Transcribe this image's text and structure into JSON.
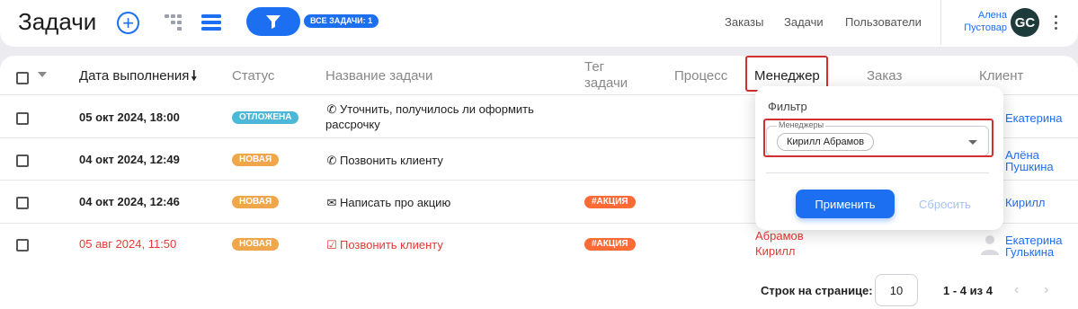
{
  "header": {
    "title": "Задачи",
    "add_symbol": "+",
    "all_tasks_badge": "ВСЕ ЗАДАЧИ: 1",
    "nav": [
      "Заказы",
      "Задачи",
      "Пользователи"
    ],
    "user": {
      "first_name": "Алена",
      "last_name": "Пустовар",
      "initials": "GC"
    }
  },
  "table": {
    "columns": {
      "due_date": "Дата выполнения",
      "sort_arrow": "🠗",
      "status": "Статус",
      "task_name": "Название задачи",
      "tag_line1": "Тег",
      "tag_line2": "задачи",
      "process": "Процесс",
      "manager": "Менеджер",
      "order": "Заказ",
      "client": "Клиент"
    },
    "rows": [
      {
        "date": "05 окт 2024, 18:00",
        "status": "ОТЛОЖЕНА",
        "status_color": "#4cb8d8",
        "task_icon": "phone-icon",
        "task_line1": "Уточнить, получилось ли оформить",
        "task_line2": "рассрочку",
        "tag": "",
        "client_line1": "Екатерина",
        "client_line2": ""
      },
      {
        "date": "04 окт 2024, 12:49",
        "status": "НОВАЯ",
        "status_color": "#f0a64a",
        "task_icon": "phone-icon",
        "task_line1": "Позвонить клиенту",
        "task_line2": "",
        "tag": "",
        "client_line1": "Алёна",
        "client_line2": "Пушкина"
      },
      {
        "date": "04 окт 2024, 12:46",
        "status": "НОВАЯ",
        "status_color": "#f0a64a",
        "task_icon": "mail-icon",
        "task_line1": "Написать про акцию",
        "task_line2": "",
        "tag": "#АКЦИЯ",
        "client_line1": "Кирилл",
        "client_line2": ""
      },
      {
        "date": "05 авг 2024, 11:50",
        "status": "НОВАЯ",
        "status_color": "#f0a64a",
        "task_icon": "checkbox-task-icon",
        "task_line1": "Позвонить клиенту",
        "task_line2": "",
        "tag": "#АКЦИЯ",
        "manager_line1": "Абрамов",
        "manager_line2": "Кирилл",
        "client_line1": "Екатерина",
        "client_line2": "Гулькина",
        "overdue": true
      }
    ]
  },
  "pagination": {
    "rows_label": "Строк на странице:",
    "rows_value": "10",
    "range": "1 - 4 из 4",
    "prev": "‹",
    "next": "›"
  },
  "filter_popup": {
    "title": "Фильтр",
    "field_label": "Менеджеры",
    "selected_chip": "Кирилл Абрамов",
    "apply": "Применить",
    "reset": "Сбросить"
  },
  "colors": {
    "accent": "#1d6ff2",
    "overdue": "#e53935",
    "tag": "#ff6b35",
    "highlight": "#d32f2f"
  }
}
